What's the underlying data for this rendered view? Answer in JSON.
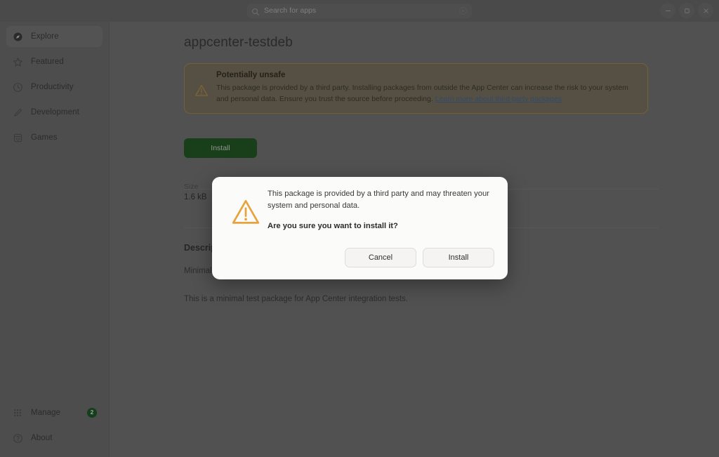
{
  "window": {
    "controls": [
      {
        "name": "minimize",
        "glyph": "minimize-icon"
      },
      {
        "name": "maximize",
        "glyph": "maximize-icon"
      },
      {
        "name": "close",
        "glyph": "close-icon"
      }
    ]
  },
  "search": {
    "icon": "search-icon",
    "placeholder": "Search for apps",
    "value": "",
    "clear_icon": "clear-icon"
  },
  "sidebar": {
    "items": [
      {
        "label": "Explore",
        "icon": "compass-icon",
        "selected": true
      },
      {
        "label": "Featured",
        "icon": "star-icon",
        "selected": false
      },
      {
        "label": "Productivity",
        "icon": "clock-icon",
        "selected": false
      },
      {
        "label": "Development",
        "icon": "pencil-icon",
        "selected": false
      },
      {
        "label": "Games",
        "icon": "gamepad-icon",
        "selected": false
      }
    ],
    "bottom_items": [
      {
        "label": "Manage",
        "icon": "grid-icon",
        "badge": "2"
      },
      {
        "label": "About",
        "icon": "question-mark-icon",
        "badge": ""
      }
    ]
  },
  "main": {
    "page_title": "appcenter-testdeb",
    "warning": {
      "icon": "warning-triangle-icon",
      "title": "Potentially unsafe",
      "text": "This package is provided by a third party. Installing packages from outside the App Center can increase the risk to your system and personal data. Ensure you trust the source before proceeding. ",
      "link_text": "Learn more about third party packages"
    },
    "install_button": "Install",
    "size_label": "Size",
    "size_value": "1.6 kB",
    "description_heading": "Description",
    "description_subtitle": "Minimal test package for App Center integration tests",
    "description_body": "This is a minimal test package for App Center integration tests."
  },
  "dialog": {
    "icon": "warning-triangle-icon",
    "message": "This package is provided by a third party and may threaten your system and personal data.",
    "question": "Are you sure you want to install it?",
    "cancel_label": "Cancel",
    "install_label": "Install"
  },
  "colors": {
    "warning_amber": "#e8a33d",
    "install_green": "#1b5a1f",
    "badge_green": "#145c20",
    "link_blue": "#4a6e9e"
  }
}
